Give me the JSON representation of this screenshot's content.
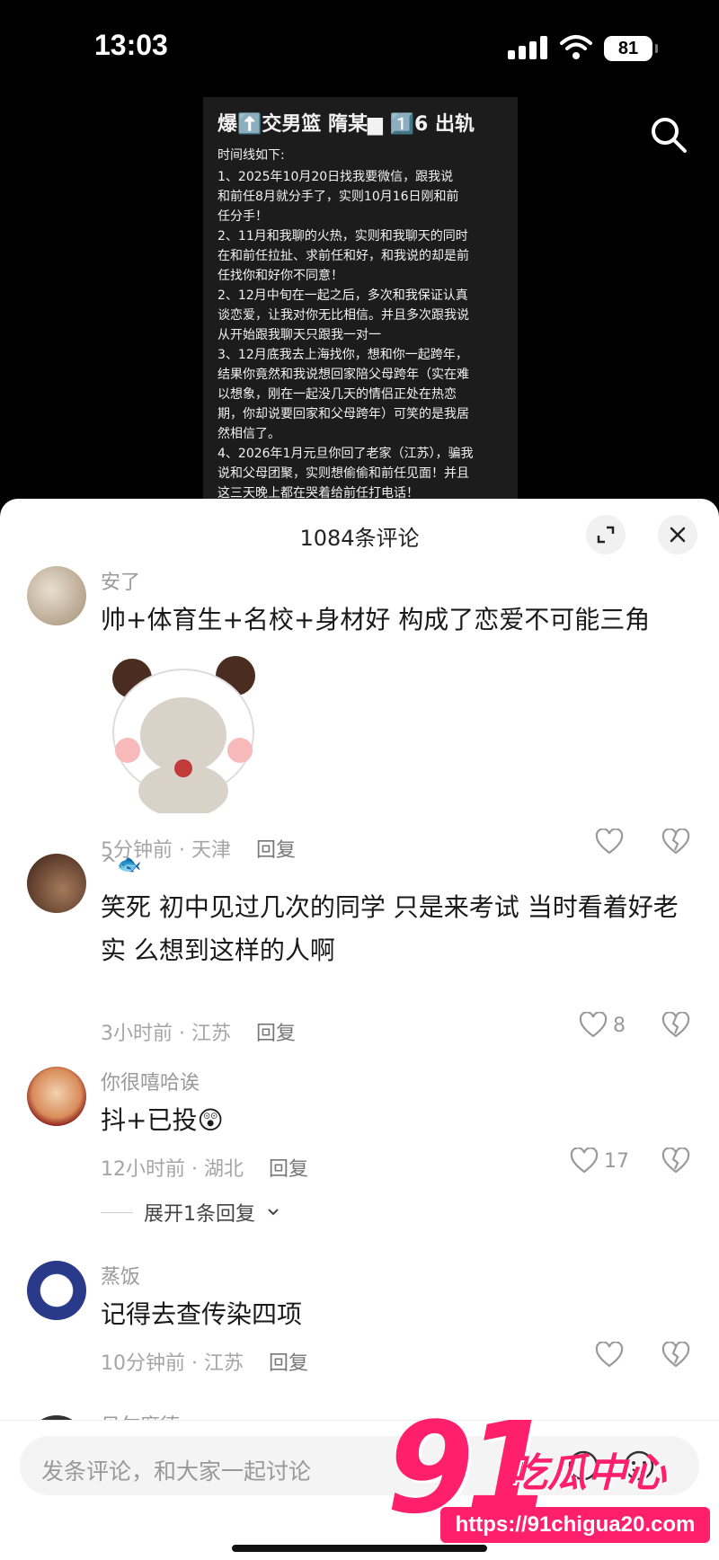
{
  "status_bar": {
    "time": "13:03",
    "battery": "81"
  },
  "post_image": {
    "title": "爆⬆️交男篮 隋某▆ 1️⃣6 出轨",
    "subtitle": "时间线如下:",
    "lines": [
      "1、2025年10月20日找我要微信，跟我说",
      "和前任8月就分手了，实则10月16日刚和前",
      "任分手！",
      "2、11月和我聊的火热，实则和我聊天的同时",
      "在和前任拉扯、求前任和好，和我说的却是前",
      "任找你和好你不同意！",
      "2、12月中旬在一起之后，多次和我保证认真",
      "谈恋爱，让我对你无比相信。并且多次跟我说",
      "从开始跟我聊天只跟我一对一",
      "3、12月底我去上海找你，想和你一起跨年，",
      "结果你竟然和我说想回家陪父母跨年（实在难",
      "以想象，刚在一起没几天的情侣正处在热恋",
      "期，你却说要回家和父母跨年）可笑的是我居",
      "然相信了。",
      "4、2026年1月元旦你回了老家（江苏），骗我",
      "说和父母团聚，实则想偷偷和前任见面！并且",
      "这三天晚上都在哭着给前任打电话！"
    ]
  },
  "sheet": {
    "title": "1084条评论"
  },
  "comments": [
    {
      "user": "安了",
      "text": "帅+体育生+名校+身材好 构成了恋爱不可能三角",
      "time": "5分钟前 · 天津",
      "reply": "回复",
      "likes": ""
    },
    {
      "user": "^🐟",
      "text": "笑死 初中见过几次的同学 只是来考试 当时看着好老实 么想到这样的人啊",
      "time": "3小时前 · 江苏",
      "reply": "回复",
      "likes": "8"
    },
    {
      "user": "你很嘻哈诶",
      "text": "抖+已投😲",
      "time": "12小时前 · 湖北",
      "reply": "回复",
      "likes": "17",
      "expand": "展开1条回复"
    },
    {
      "user": "蒸饭",
      "text": "记得去查传染四项",
      "time": "10分钟前 · 江苏",
      "reply": "回复",
      "likes": ""
    },
    {
      "user": "贝尔摩德"
    }
  ],
  "input": {
    "placeholder": "发条评论，和大家一起讨论"
  },
  "watermark": {
    "big": "91",
    "text": "吃瓜中心",
    "url": "https://91chigua20.com"
  },
  "colors": {
    "accent": "#ff1f6b",
    "highlight_blue": "#1f5da8",
    "highlight_red": "#ff5a6e"
  }
}
